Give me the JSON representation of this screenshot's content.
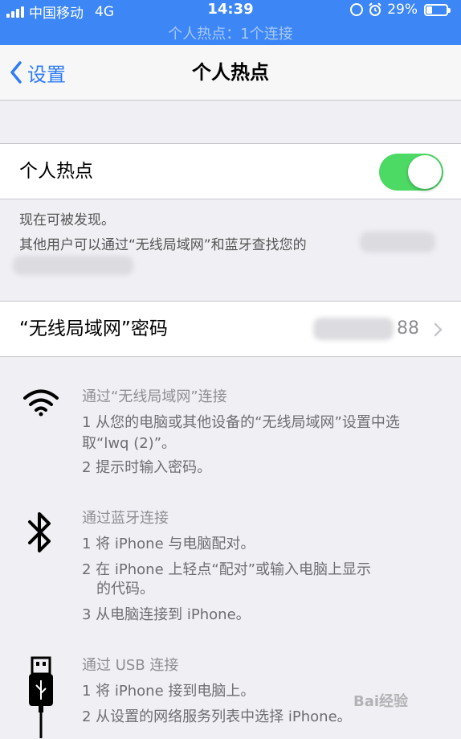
{
  "status_bar": {
    "carrier": "中国移动",
    "network": "4G",
    "time": "14:39",
    "battery": "29%",
    "battery_level": 0.29,
    "hotspot_banner": "个人热点：1个连接"
  },
  "nav": {
    "back_label": "设置",
    "title": "个人热点"
  },
  "hotspot": {
    "label": "个人热点",
    "enabled": true,
    "discoverable_text": "现在可被发现。",
    "description": "其他用户可以通过“无线局域网”和蓝牙查找您的"
  },
  "wifi_password": {
    "label": "“无线局域网”密码",
    "value_suffix": "88"
  },
  "instructions": {
    "wifi": {
      "title": "通过“无线局域网”连接",
      "step1_line1": "1 从您的电脑或其他设备的“无线局域网”设置中选",
      "step1_line2": "取“lwq (2)”。",
      "step2": "2 提示时输入密码。"
    },
    "bluetooth": {
      "title": "通过蓝牙连接",
      "step1": "1 将 iPhone 与电脑配对。",
      "step2_line1": "2 在 iPhone 上轻点“配对”或输入电脑上显示",
      "step2_line2": "的代码。",
      "step3": "3 从电脑连接到 iPhone。"
    },
    "usb": {
      "title": "通过 USB 连接",
      "step1": "1 将 iPhone 接到电脑上。",
      "step2": "2 从设置的网络服务列表中选择 iPhone。"
    }
  },
  "watermark": "Bai经验",
  "colors": {
    "status_bar": "#3c86f6",
    "accent": "#2f7cf6",
    "toggle_on": "#4cd964",
    "background": "#efeff4"
  }
}
